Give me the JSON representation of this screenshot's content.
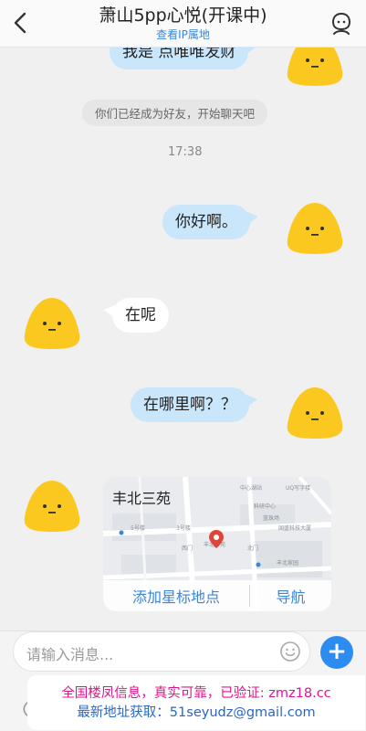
{
  "header": {
    "title": "萧山5pp心悦(开课中)",
    "subtitle": "查看IP属地"
  },
  "messages": {
    "partial_top": "我是 点唯唯发财",
    "system_notice": "你们已经成为好友，开始聊天吧",
    "time": "17:38",
    "msg1": "你好啊。",
    "msg2": "在呢",
    "msg3": "在哪里啊？？"
  },
  "map": {
    "title": "丰北三苑",
    "action_add": "添加星标地点",
    "action_nav": "导航",
    "labels": {
      "a": "中心湖站",
      "b": "科研中心",
      "c": "蓝珠场",
      "d": "UQ写字楼",
      "e": "国盛科技大厦",
      "f": "西门",
      "g": "北门",
      "h": "丰北三苑",
      "i": "丰北家园",
      "j": "3号楼",
      "k": "5号楼"
    }
  },
  "input": {
    "placeholder": "请输入消息..."
  },
  "promo": {
    "line1": "全国楼凤信息，真实可靠，已验证: zmz18.cc",
    "line2": "最新地址获取：51seyudz@gmail.com"
  },
  "colors": {
    "accent": "#2d8cf0",
    "bubble_out": "#c9e6fb",
    "avatar_yellow": "#fbc820",
    "promo_pink": "#e0158c",
    "promo_blue": "#2a66c8"
  }
}
